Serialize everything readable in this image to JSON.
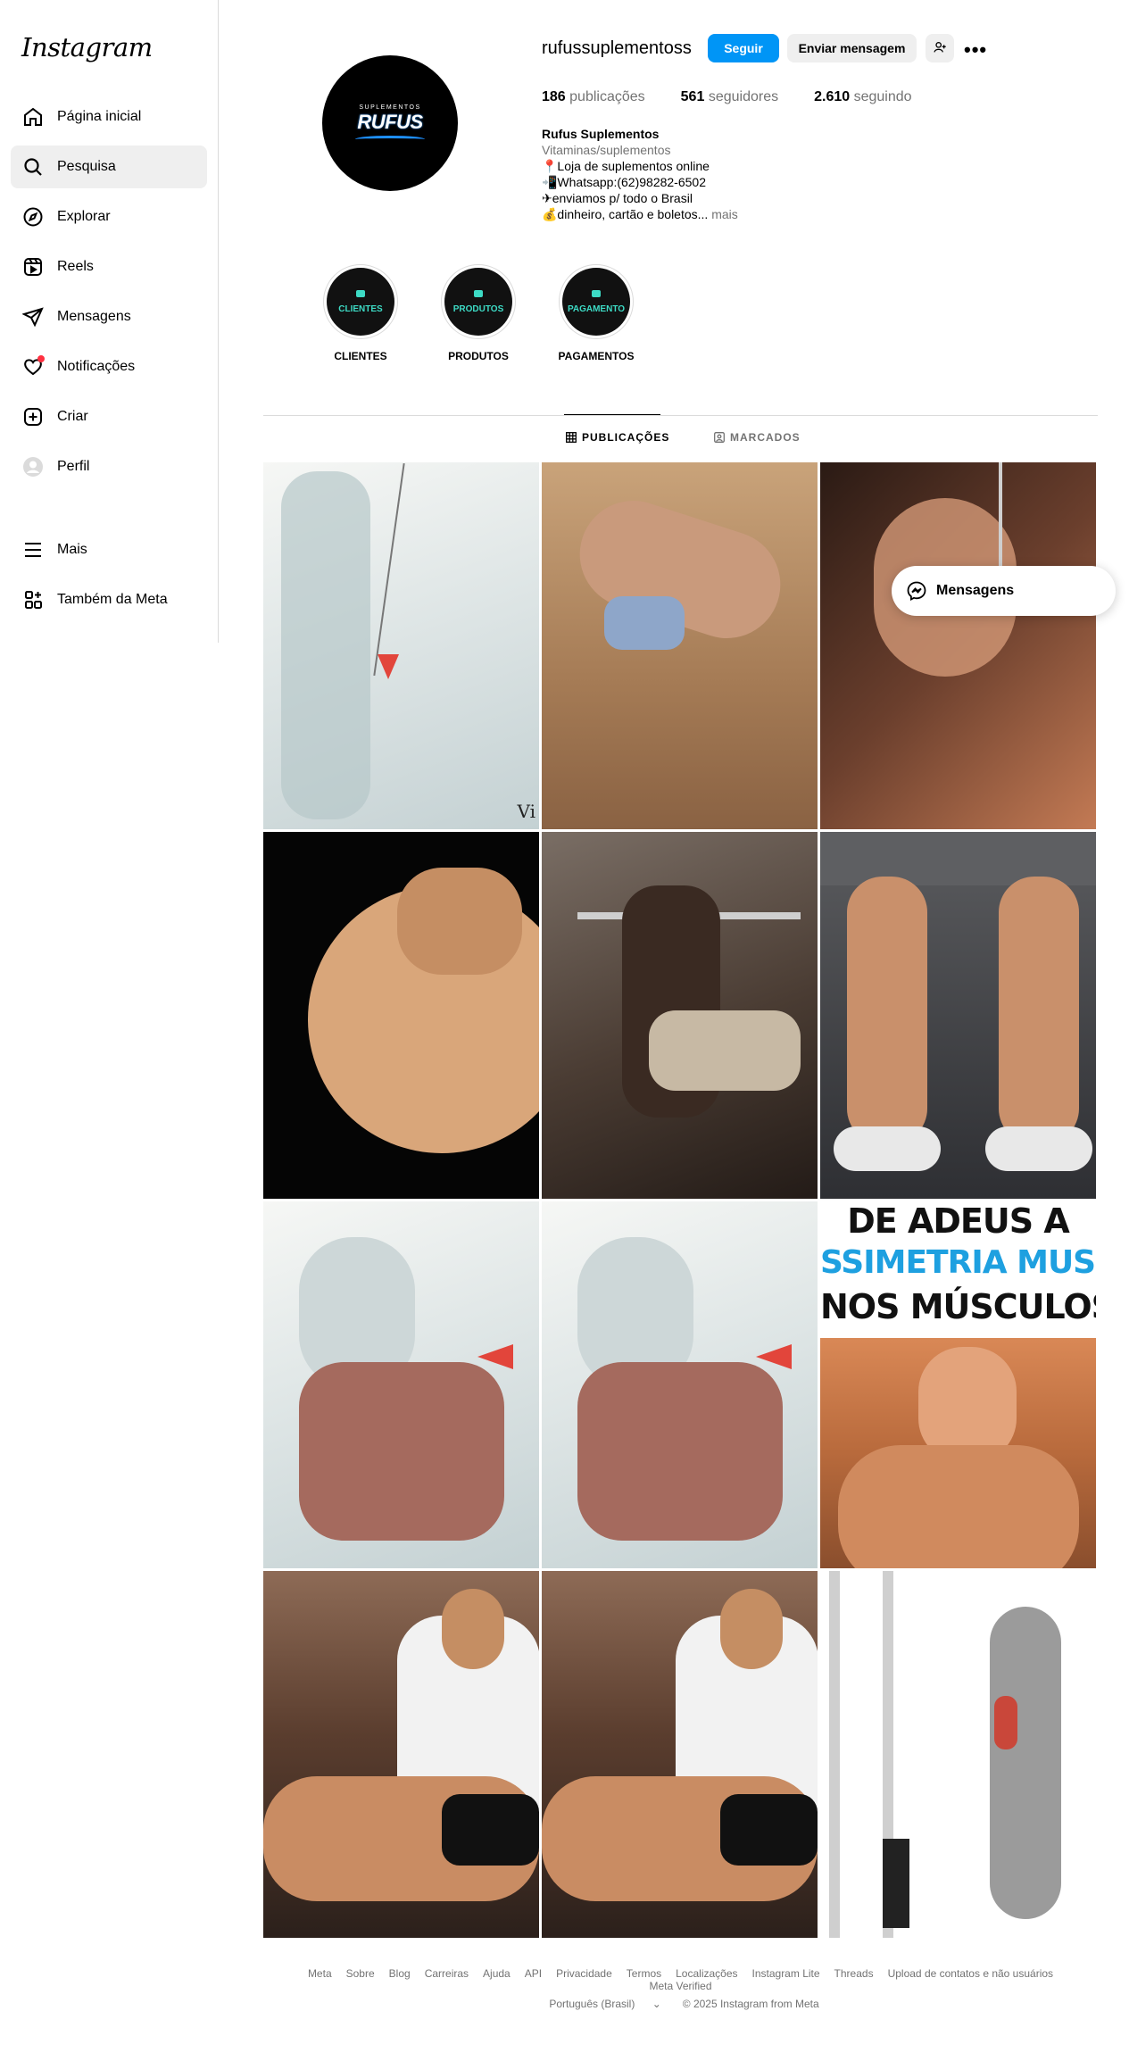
{
  "sidebar": {
    "logo": "Instagram",
    "items": [
      {
        "label": "Página inicial",
        "icon": "home-icon"
      },
      {
        "label": "Pesquisa",
        "icon": "search-icon",
        "active": true
      },
      {
        "label": "Explorar",
        "icon": "compass-icon"
      },
      {
        "label": "Reels",
        "icon": "reels-icon"
      },
      {
        "label": "Mensagens",
        "icon": "send-icon"
      },
      {
        "label": "Notificações",
        "icon": "heart-icon"
      },
      {
        "label": "Criar",
        "icon": "plus-square-icon"
      },
      {
        "label": "Perfil",
        "icon": "profile-icon"
      }
    ],
    "bottom_items": [
      {
        "label": "Mais",
        "icon": "menu-icon"
      },
      {
        "label": "Também da Meta",
        "icon": "meta-apps-icon"
      }
    ]
  },
  "profile": {
    "avatar_small": "SUPLEMENTOS",
    "avatar_brand": "RUFUS",
    "username": "rufussuplementoss",
    "follow_label": "Seguir",
    "message_label": "Enviar mensagem",
    "stats": {
      "posts_count": "186",
      "posts_label": "publicações",
      "followers_count": "561",
      "followers_label": "seguidores",
      "following_count": "2.610",
      "following_label": "seguindo"
    },
    "bio": {
      "name": "Rufus Suplementos",
      "category": "Vitaminas/suplementos",
      "line1": "📍Loja de suplementos online",
      "line2": "📲Whatsapp:(62)98282-6502",
      "line3": "✈enviamos p/ todo o Brasil",
      "line4": "💰dinheiro, cartão e boletos...",
      "more": "mais"
    }
  },
  "highlights": [
    {
      "title": "CLIENTES",
      "label": "CLIENTES"
    },
    {
      "title": "PRODUTOS",
      "label": "PRODUTOS"
    },
    {
      "title": "PAGAMENTO",
      "label": "PAGAMENTOS"
    }
  ],
  "tabs": {
    "posts": "PUBLICAÇÕES",
    "tagged": "MARCADOS"
  },
  "posts": {
    "watermark": "Vi",
    "poster_line1": "DE ADEUS A",
    "poster_line2": "SSIMETRIA MUSCULA",
    "poster_line3": "NOS MÚSCULOS"
  },
  "floating_messages": "Mensagens",
  "footer": {
    "links": [
      "Meta",
      "Sobre",
      "Blog",
      "Carreiras",
      "Ajuda",
      "API",
      "Privacidade",
      "Termos",
      "Localizações",
      "Instagram Lite",
      "Threads",
      "Upload de contatos e não usuários",
      "Meta Verified"
    ],
    "language": "Português (Brasil)",
    "copyright": "© 2025 Instagram from Meta"
  },
  "colors": {
    "primary_blue": "#0095f6",
    "notification_red": "#ff3040",
    "highlight_teal": "#3ddbc5"
  }
}
